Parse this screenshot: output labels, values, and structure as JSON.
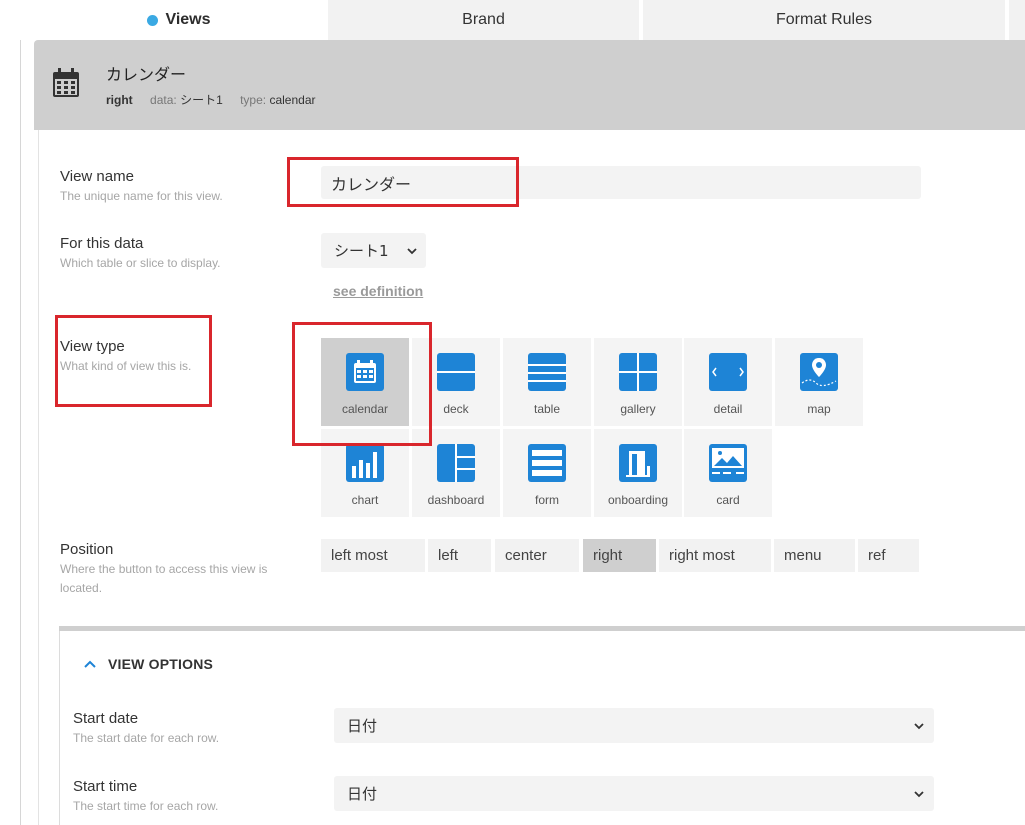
{
  "tabs": [
    {
      "label": "Views",
      "active": true
    },
    {
      "label": "Brand",
      "active": false
    },
    {
      "label": "Format Rules",
      "active": false
    }
  ],
  "header": {
    "icon": "calendar-icon",
    "title": "カレンダー",
    "position": "right",
    "data_key": "data:",
    "data_value": "シート1",
    "type_key": "type:",
    "type_value": "calendar"
  },
  "fields": {
    "view_name": {
      "label": "View name",
      "help": "The unique name for this view.",
      "value": "カレンダー"
    },
    "for_data": {
      "label": "For this data",
      "help": "Which table or slice to display.",
      "value": "シート1",
      "link": "see definition"
    },
    "view_type": {
      "label": "View type",
      "help": "What kind of view this is."
    },
    "position": {
      "label": "Position",
      "help": "Where the button to access this view is located."
    }
  },
  "view_types": [
    {
      "label": "calendar",
      "icon": "calendar-icon",
      "selected": true
    },
    {
      "label": "deck",
      "icon": "deck-icon",
      "selected": false
    },
    {
      "label": "table",
      "icon": "table-icon",
      "selected": false
    },
    {
      "label": "gallery",
      "icon": "gallery-icon",
      "selected": false
    },
    {
      "label": "detail",
      "icon": "detail-icon",
      "selected": false
    },
    {
      "label": "map",
      "icon": "map-icon",
      "selected": false
    },
    {
      "label": "chart",
      "icon": "chart-icon",
      "selected": false
    },
    {
      "label": "dashboard",
      "icon": "dashboard-icon",
      "selected": false
    },
    {
      "label": "form",
      "icon": "form-icon",
      "selected": false
    },
    {
      "label": "onboarding",
      "icon": "onboarding-icon",
      "selected": false
    },
    {
      "label": "card",
      "icon": "card-icon",
      "selected": false
    }
  ],
  "positions": [
    {
      "label": "left most",
      "selected": false
    },
    {
      "label": "left",
      "selected": false
    },
    {
      "label": "center",
      "selected": false
    },
    {
      "label": "right",
      "selected": true
    },
    {
      "label": "right most",
      "selected": false
    },
    {
      "label": "menu",
      "selected": false
    },
    {
      "label": "ref",
      "selected": false
    }
  ],
  "view_options": {
    "title": "VIEW OPTIONS",
    "start_date": {
      "label": "Start date",
      "help": "The start date for each row.",
      "value": "日付"
    },
    "start_time": {
      "label": "Start time",
      "help": "The start time for each row.",
      "value": "日付"
    }
  },
  "colors": {
    "accent": "#1e84d6",
    "tab_dot": "#3aa9e3",
    "annotation_red": "#d9262c",
    "selected_bg": "#cfcfcf"
  }
}
